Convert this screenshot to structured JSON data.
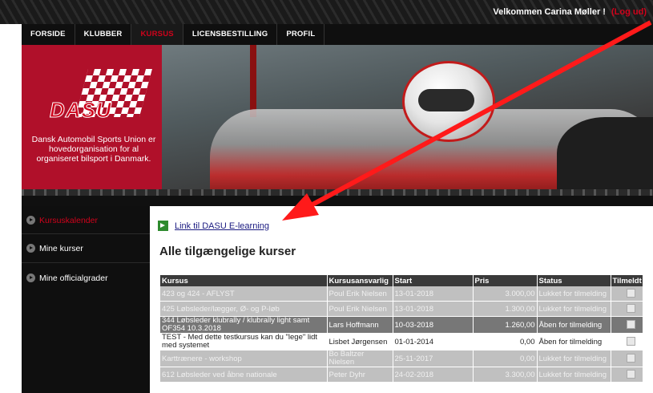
{
  "header": {
    "welcome": "Velkommen Carina Møller !",
    "logout": "(Log ud)"
  },
  "nav": {
    "items": [
      {
        "label": "FORSIDE"
      },
      {
        "label": "KLUBBER"
      },
      {
        "label": "KURSUS"
      },
      {
        "label": "LICENSBESTILLING"
      },
      {
        "label": "PROFIL"
      }
    ],
    "active": "KURSUS"
  },
  "brand": {
    "logo_text": "DASU",
    "tagline": "Dansk Automobil Sports Union er hovedorganisation for al organiseret bilsport i Danmark."
  },
  "sidebar": {
    "items": [
      {
        "label": "Kursuskalender"
      },
      {
        "label": "Mine kurser"
      },
      {
        "label": "Mine officialgrader"
      }
    ]
  },
  "content": {
    "elearning_link": "Link til DASU E-learning",
    "title": "Alle tilgængelige kurser"
  },
  "table": {
    "headers": [
      "Kursus",
      "Kursusansvarlig",
      "Start",
      "Pris",
      "Status",
      "Tilmeldt"
    ],
    "rows": [
      {
        "kursus": "423 og 424 - AFLYST",
        "ansvarlig": "Poul Erik Nielsen",
        "start": "13-01-2018",
        "pris": "3.000,00",
        "status": "Lukket for tilmelding"
      },
      {
        "kursus": "425 Løbsleder/lægger, Ø- og P-løb",
        "ansvarlig": "Poul Erik Nielsen",
        "start": "13-01-2018",
        "pris": "1.300,00",
        "status": "Lukket for tilmelding"
      },
      {
        "kursus": "344 Løbsleder klubrally / klubrally light samt OF354 10.3.2018",
        "ansvarlig": "Lars Hoffmann",
        "start": "10-03-2018",
        "pris": "1.260,00",
        "status": "Åben for tilmelding"
      },
      {
        "kursus": "TEST - Med dette testkursus kan du \"lege\" lidt med systemet",
        "ansvarlig": "Lisbet Jørgensen",
        "start": "01-01-2014",
        "pris": "0,00",
        "status": "Åben for tilmelding"
      },
      {
        "kursus": "Karttrænere - workshop",
        "ansvarlig": "Bo Baltzer Nielsen",
        "start": "25-11-2017",
        "pris": "0,00",
        "status": "Lukket for tilmelding"
      },
      {
        "kursus": "612 Løbsleder ved åbne nationale",
        "ansvarlig": "Peter Dyhr",
        "start": "24-02-2018",
        "pris": "3.300,00",
        "status": "Lukket for tilmelding"
      }
    ]
  },
  "colors": {
    "accent": "#d0021b",
    "arrow": "#ff1a1a",
    "nav_bg": "#0f0f0f"
  }
}
